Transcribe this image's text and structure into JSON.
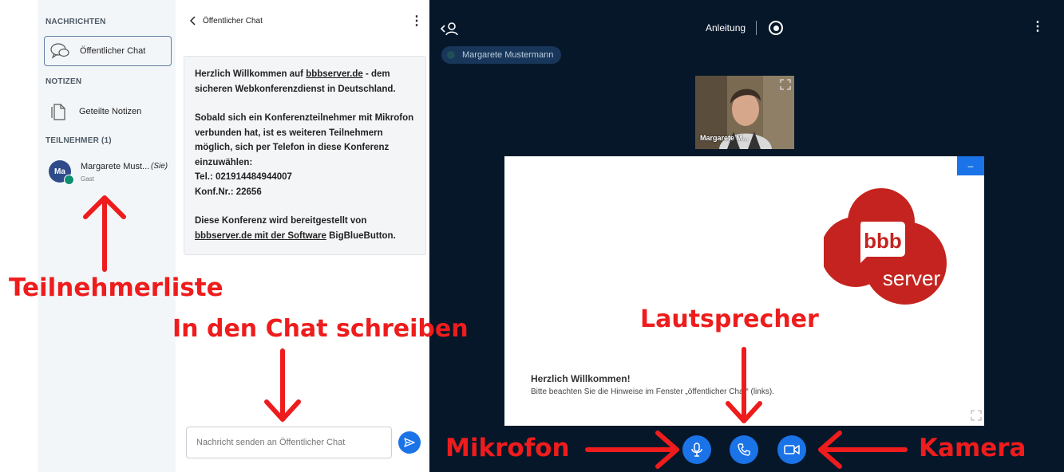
{
  "sidebar": {
    "messages_title": "NACHRICHTEN",
    "public_chat_label": "Öffentlicher Chat",
    "notes_title": "NOTIZEN",
    "shared_notes_label": "Geteilte Notizen",
    "participants_title": "TEILNEHMER (1)",
    "user": {
      "initials": "Ma",
      "name": "Margarete Must...",
      "you": "(Sie)",
      "role": "Gast"
    }
  },
  "chat": {
    "title": "Öffentlicher Chat",
    "welcome": {
      "line1_pre": "Herzlich Willkommen auf ",
      "line1_link": "bbbserver.de",
      "line1_post": " - dem sicheren Webkonferenzdienst in Deutschland.",
      "para2": "Sobald sich ein Konferenzteilnehmer mit Mikrofon verbunden hat, ist es weiteren Teilnehmern möglich, sich per Telefon in diese Konferenz einzuwählen:",
      "tel": "Tel.: 021914484944007",
      "conf_nr": "Konf.Nr.: 22656",
      "para3_pre": "Diese Konferenz wird bereitgestellt von ",
      "para3_link": "bbbserver.de mit der Software",
      "para3_post": " BigBlueButton."
    },
    "input_placeholder": "Nachricht senden an Öffentlicher Chat"
  },
  "conference": {
    "topbar_title": "Anleitung",
    "talker_name": "Margarete Mustermann",
    "webcam_label": "Margarete M...",
    "slide": {
      "logo_top": "bbb",
      "logo_bottom": "server",
      "minimize_label": "–",
      "title": "Herzlich Willkommen!",
      "subtitle": "Bitte beachten Sie die Hinweise im Fenster „öffentlicher Chat“ (links)."
    }
  },
  "annotations": {
    "participants": "Teilnehmerliste",
    "chat_write": "In den Chat schreiben",
    "speaker": "Lautsprecher",
    "microphone": "Mikrofon",
    "camera": "Kamera"
  },
  "colors": {
    "annotation_red": "#ee1c1c",
    "accent_blue": "#1b73e8",
    "conference_bg": "#06172a",
    "logo_red": "#c5231f"
  }
}
